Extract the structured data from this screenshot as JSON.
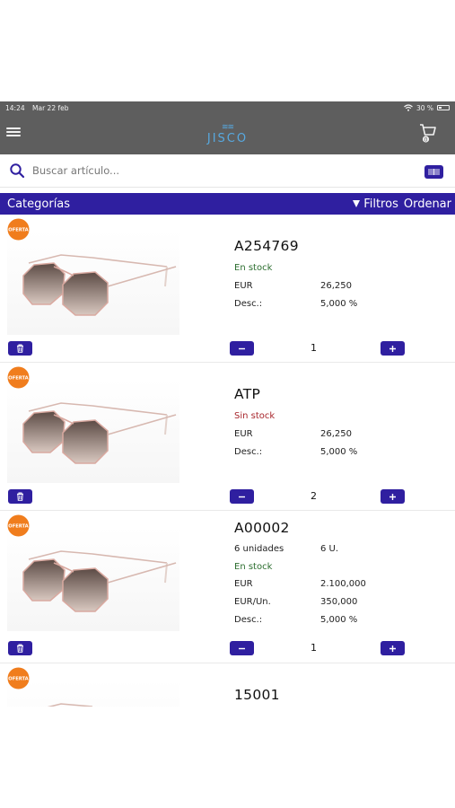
{
  "status": {
    "time": "14:24",
    "date": "Mar 22 feb",
    "battery": "30 %"
  },
  "app": {
    "logo_text": "JISCO",
    "logo_mark": "≋≋",
    "cart_count": "0"
  },
  "search": {
    "placeholder": "Buscar artículo..."
  },
  "filterbar": {
    "categories_label": "Categorías",
    "filters_label": "Filtros",
    "order_label": "Ordenar"
  },
  "badge": {
    "label": "OFERTA"
  },
  "colors": {
    "accent": "#2f1fa0",
    "topbar": "#5e5e5e",
    "logo": "#57a9e0",
    "in_stock": "#2c6e2f",
    "out_stock": "#a8262c",
    "badge": "#f07d1d"
  },
  "products": [
    {
      "sku": "A254769",
      "stock": "En stock",
      "rows": [
        {
          "label": "EUR",
          "value": "26,250"
        },
        {
          "label": "Desc.:",
          "value": "5,000 %"
        }
      ],
      "qty": "1"
    },
    {
      "sku": "ATP",
      "stock": "Sin stock",
      "rows": [
        {
          "label": "EUR",
          "value": "26,250"
        },
        {
          "label": "Desc.:",
          "value": "5,000 %"
        }
      ],
      "qty": "2"
    },
    {
      "sku": "A00002",
      "units_label": "6 unidades",
      "units_value": "6 U.",
      "stock": "En stock",
      "rows": [
        {
          "label": "EUR",
          "value": "2.100,000"
        },
        {
          "label": "EUR/Un.",
          "value": "350,000"
        },
        {
          "label": "Desc.:",
          "value": "5,000 %"
        }
      ],
      "qty": "1"
    },
    {
      "sku": "15001"
    }
  ]
}
